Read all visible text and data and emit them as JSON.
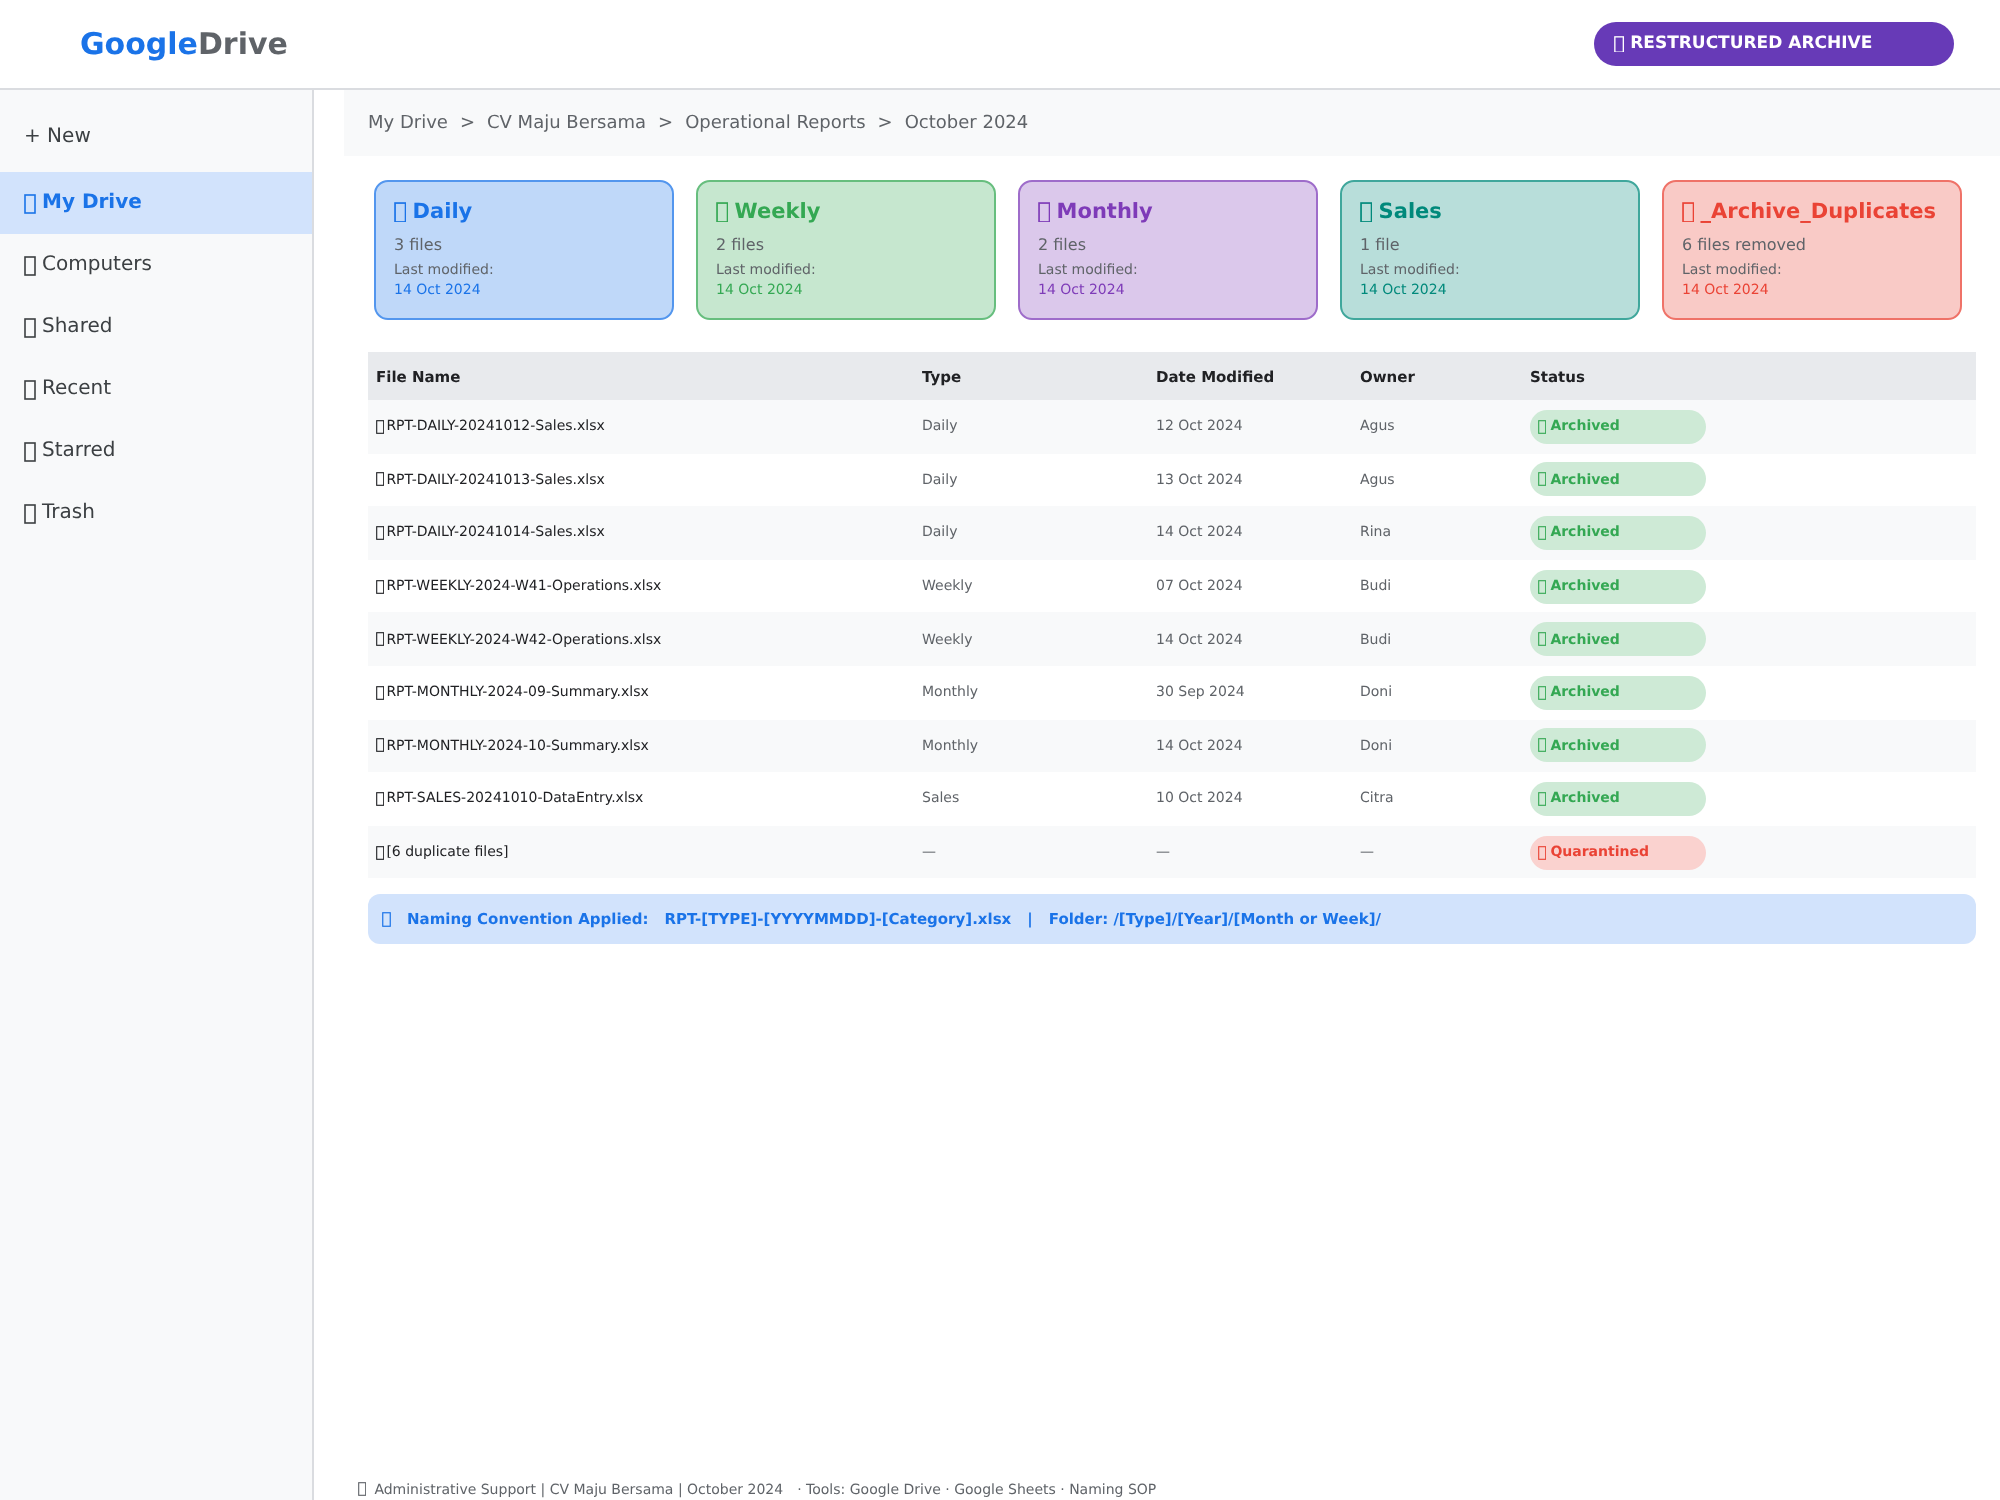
{
  "header": {
    "logo": [
      "Google",
      "Drive"
    ],
    "badge": "RESTRUCTURED ARCHIVE"
  },
  "sidebar": {
    "new_button": "+ New",
    "items": [
      {
        "label": "My Drive",
        "selected": true
      },
      {
        "label": "Computers",
        "selected": false
      },
      {
        "label": "Shared",
        "selected": false
      },
      {
        "label": "Recent",
        "selected": false
      },
      {
        "label": "Starred",
        "selected": false
      },
      {
        "label": "Trash",
        "selected": false
      }
    ]
  },
  "breadcrumb": [
    {
      "label": "My Drive"
    },
    {
      "separator": ">",
      "label": "CV Maju Bersama"
    },
    {
      "separator": ">",
      "label": "Operational Reports"
    },
    {
      "separator": ">",
      "label": "October 2024"
    }
  ],
  "folders": [
    {
      "name": "Daily",
      "count": "3 files",
      "modified_label": "Last modified:",
      "modified": "14 Oct 2024",
      "color": "#1a73e8"
    },
    {
      "name": "Weekly",
      "count": "2 files",
      "modified_label": "Last modified:",
      "modified": "14 Oct 2024",
      "color": "#34a853"
    },
    {
      "name": "Monthly",
      "count": "2 files",
      "modified_label": "Last modified:",
      "modified": "14 Oct 2024",
      "color": "#7e3bb8"
    },
    {
      "name": "Sales",
      "count": "1 file",
      "modified_label": "Last modified:",
      "modified": "14 Oct 2024",
      "color": "#00897b"
    },
    {
      "name": "_Archive_Duplicates",
      "count": "6 files removed",
      "modified_label": "Last modified:",
      "modified": "14 Oct 2024",
      "color": "#ea4335"
    }
  ],
  "table": {
    "columns": [
      "File Name",
      "Type",
      "Date Modified",
      "Owner",
      "Status"
    ],
    "rows": [
      {
        "file_name": "RPT-DAILY-20241012-Sales.xlsx",
        "type": "Daily",
        "date_modified": "12 Oct 2024",
        "owner": "Agus",
        "status": {
          "kind": "archived",
          "label": "Archived"
        }
      },
      {
        "file_name": "RPT-DAILY-20241013-Sales.xlsx",
        "type": "Daily",
        "date_modified": "13 Oct 2024",
        "owner": "Agus",
        "status": {
          "kind": "archived",
          "label": "Archived"
        }
      },
      {
        "file_name": "RPT-DAILY-20241014-Sales.xlsx",
        "type": "Daily",
        "date_modified": "14 Oct 2024",
        "owner": "Rina",
        "status": {
          "kind": "archived",
          "label": "Archived"
        }
      },
      {
        "file_name": "RPT-WEEKLY-2024-W41-Operations.xlsx",
        "type": "Weekly",
        "date_modified": "07 Oct 2024",
        "owner": "Budi",
        "status": {
          "kind": "archived",
          "label": "Archived"
        }
      },
      {
        "file_name": "RPT-WEEKLY-2024-W42-Operations.xlsx",
        "type": "Weekly",
        "date_modified": "14 Oct 2024",
        "owner": "Budi",
        "status": {
          "kind": "archived",
          "label": "Archived"
        }
      },
      {
        "file_name": "RPT-MONTHLY-2024-09-Summary.xlsx",
        "type": "Monthly",
        "date_modified": "30 Sep 2024",
        "owner": "Doni",
        "status": {
          "kind": "archived",
          "label": "Archived"
        }
      },
      {
        "file_name": "RPT-MONTHLY-2024-10-Summary.xlsx",
        "type": "Monthly",
        "date_modified": "14 Oct 2024",
        "owner": "Doni",
        "status": {
          "kind": "archived",
          "label": "Archived"
        }
      },
      {
        "file_name": "RPT-SALES-20241010-DataEntry.xlsx",
        "type": "Sales",
        "date_modified": "10 Oct 2024",
        "owner": "Citra",
        "status": {
          "kind": "archived",
          "label": "Archived"
        }
      },
      {
        "file_name": "[6 duplicate files]",
        "type": "—",
        "date_modified": "—",
        "owner": "—",
        "status": {
          "kind": "quarantined",
          "label": "Quarantined"
        }
      }
    ]
  },
  "banner": {
    "parts": [
      "Naming Convention Applied:",
      "RPT-[TYPE]-[YYYYMMDD]-[Category].xlsx",
      "|",
      "Folder: /[Type]/[Year]/[Month or Week]/"
    ]
  },
  "footer": {
    "credit": "Administrative Support | CV Maju Bersama | October 2024",
    "tools": "· Tools: Google Drive · Google Sheets · Naming SOP"
  }
}
